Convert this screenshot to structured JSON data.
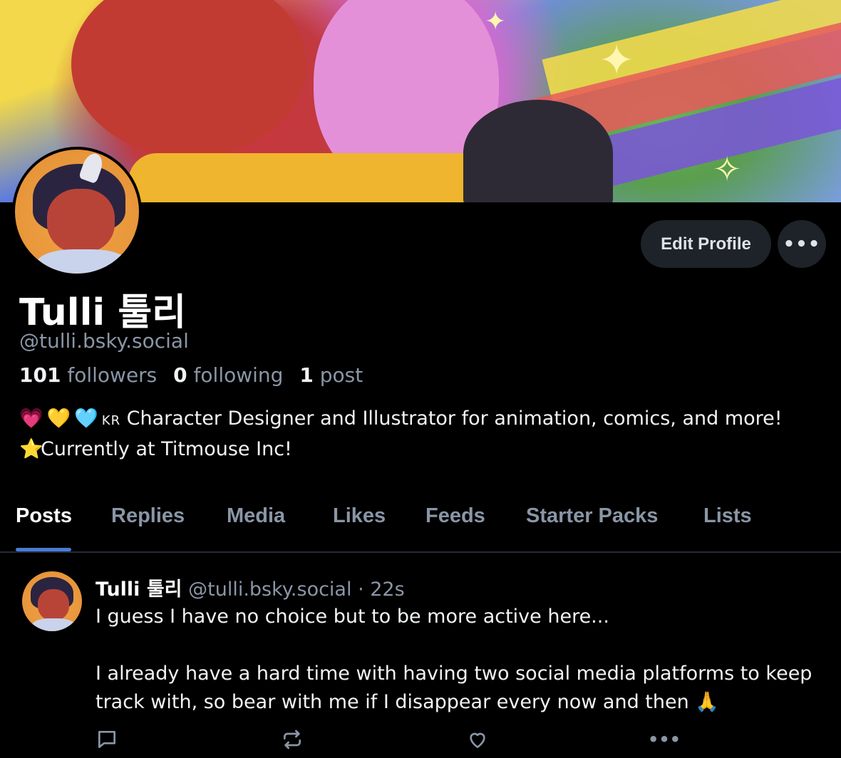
{
  "profile": {
    "display_name": "Tulli 툴리",
    "handle": "@tulli.bsky.social",
    "stats": {
      "followers_count": "101",
      "followers_label": "followers",
      "following_count": "0",
      "following_label": "following",
      "posts_count": "1",
      "posts_label": "post"
    },
    "bio": {
      "line1_emojis": [
        "💗",
        "💛",
        "🩵"
      ],
      "line1_flag": "KR",
      "line1_text": " Character Designer and Illustrator for animation, comics, and more!",
      "line2_emoji": "⭐",
      "line2_text": "Currently at Titmouse Inc!"
    }
  },
  "actions": {
    "edit_label": "Edit Profile",
    "more_label": "•••"
  },
  "tabs": [
    {
      "label": "Posts",
      "active": true
    },
    {
      "label": "Replies",
      "active": false
    },
    {
      "label": "Media",
      "active": false
    },
    {
      "label": "Likes",
      "active": false
    },
    {
      "label": "Feeds",
      "active": false
    },
    {
      "label": "Starter Packs",
      "active": false
    },
    {
      "label": "Lists",
      "active": false
    }
  ],
  "post": {
    "author": "Tulli 툴리",
    "handle": "@tulli.bsky.social",
    "separator": " · ",
    "time": "22s",
    "line1": "I guess I have no choice but to be more active here...",
    "line2": "I already have a hard time with having two social media platforms to keep",
    "line3": "track with, so bear with me if I disappear every now and then ",
    "line3_emoji": "🙏",
    "more_label": "•••"
  },
  "icons": {
    "reply": "speech-bubble-icon",
    "repost": "repost-icon",
    "like": "heart-icon",
    "more": "ellipsis-icon"
  },
  "colors": {
    "background": "#000000",
    "accent": "#4a7bd8",
    "muted_text": "#8a96a6",
    "button_bg": "#1e2329"
  }
}
